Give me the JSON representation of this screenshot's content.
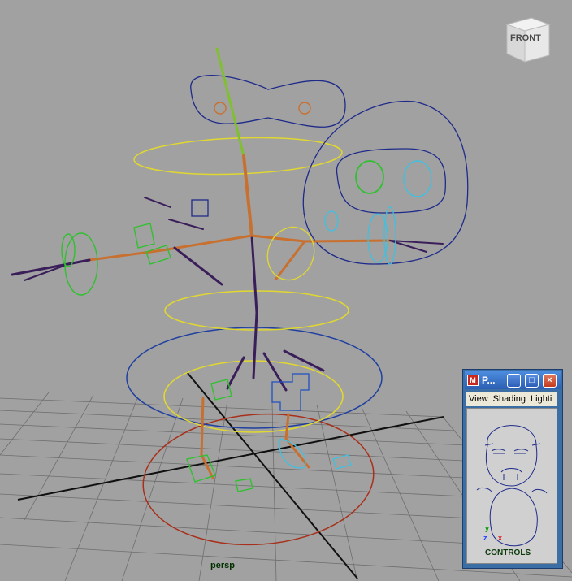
{
  "viewport": {
    "camera_label": "persp",
    "viewcube_face": "FRONT"
  },
  "mini_panel": {
    "title": "P...",
    "app_icon": "maya-icon",
    "buttons": {
      "minimize": "_",
      "maximize": "□",
      "close": "×"
    },
    "menu": [
      "View",
      "Shading",
      "Lighti"
    ],
    "axis": {
      "y": "y",
      "z": "z",
      "x": "x"
    },
    "camera_label": "CONTROLS"
  },
  "colors": {
    "background": "#a1a1a1",
    "grid": "#707070",
    "curve_blue": "#1e2a8a",
    "curve_yellow": "#e6e030",
    "curve_green": "#30c030",
    "curve_cyan": "#40c8e0",
    "bone_orange": "#c87030",
    "bone_purple": "#3a1e5a",
    "curve_red": "#b03010"
  }
}
